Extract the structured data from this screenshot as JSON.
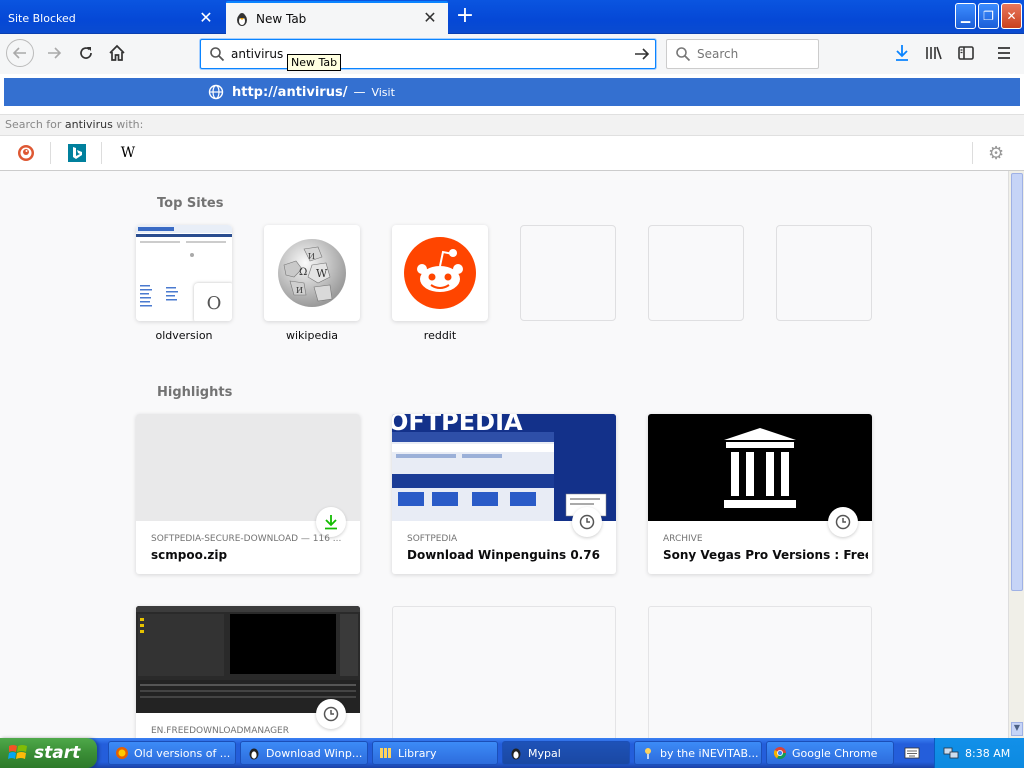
{
  "tabs": [
    {
      "label": "Site Blocked"
    },
    {
      "label": "New Tab"
    }
  ],
  "tooltip": "New Tab",
  "urlbar": {
    "value": "antivirus"
  },
  "searchbar": {
    "placeholder": "Search"
  },
  "dropdown": {
    "result_url": "http://antivirus/",
    "result_sep": "—",
    "result_action": "Visit",
    "oneoff_prefix": "Search for ",
    "oneoff_term": "antivirus",
    "oneoff_suffix": " with:",
    "wikipedia_glyph": "W"
  },
  "top_sites": {
    "title": "Top Sites",
    "items": [
      {
        "label": "oldversion",
        "overlay_letter": "O"
      },
      {
        "label": "wikipedia"
      },
      {
        "label": "reddit"
      }
    ]
  },
  "highlights": {
    "title": "Highlights",
    "items": [
      {
        "meta": "SOFTPEDIA-SECURE-DOWNLOAD — 116 ...",
        "title": "scmpoo.zip",
        "badge": "download-icon"
      },
      {
        "meta": "SOFTPEDIA",
        "title": "Download Winpenguins 0.76",
        "badge": "clock-icon",
        "banner": "OFTPEDIA"
      },
      {
        "meta": "ARCHIVE",
        "title": "Sony Vegas Pro Versions : Free D...",
        "badge": "clock-icon"
      },
      {
        "meta": "EN.FREEDOWNLOADMANAGER",
        "title": "",
        "badge": "clock-icon"
      }
    ]
  },
  "taskbar": {
    "start_label": "start",
    "tasks": [
      {
        "label": "Old versions of ..."
      },
      {
        "label": "Download Winp..."
      },
      {
        "label": "Library"
      },
      {
        "label": "Mypal"
      },
      {
        "label": "by the iNEViTAB..."
      },
      {
        "label": "Google Chrome"
      }
    ],
    "clock": "8:38 AM"
  },
  "colors": {
    "accent": "#0a84ff",
    "selection": "#3470d0",
    "reddit": "#ff4500",
    "xp_taskbar": "#245edb"
  }
}
